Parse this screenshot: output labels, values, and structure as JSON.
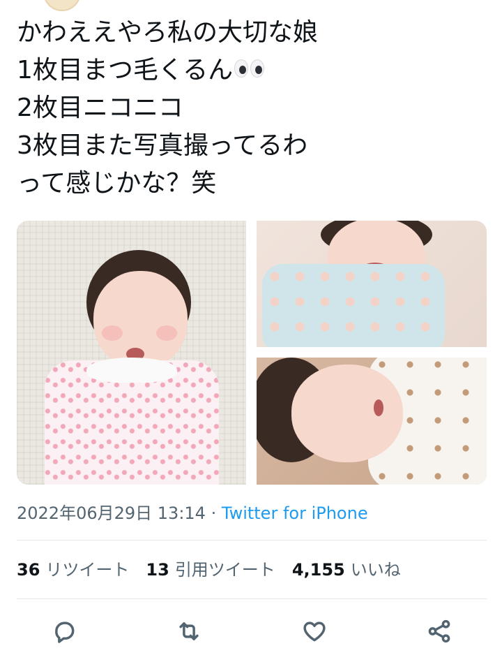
{
  "tweet": {
    "lines": [
      "かわええやろ私の大切な娘",
      "1枚目まつ毛くるん",
      "2枚目ニコニコ",
      "3枚目また写真撮ってるわ",
      "って感じかな？笑"
    ],
    "emoji": "eyes-emoji"
  },
  "meta": {
    "datetime": "2022年06月29日 13:14",
    "separator": "·",
    "source": "Twitter for iPhone"
  },
  "stats": {
    "retweets": {
      "count": "36",
      "label": "リツイート"
    },
    "quotes": {
      "count": "13",
      "label": "引用ツイート"
    },
    "likes": {
      "count": "4,155",
      "label": "いいね"
    }
  },
  "actions": {
    "reply_icon": "reply-icon",
    "retweet_icon": "retweet-icon",
    "like_icon": "heart-icon",
    "share_icon": "share-icon"
  },
  "colors": {
    "text": "#0f1419",
    "secondary": "#536471",
    "link": "#1d9bf0",
    "divider": "#e1e6ea"
  }
}
